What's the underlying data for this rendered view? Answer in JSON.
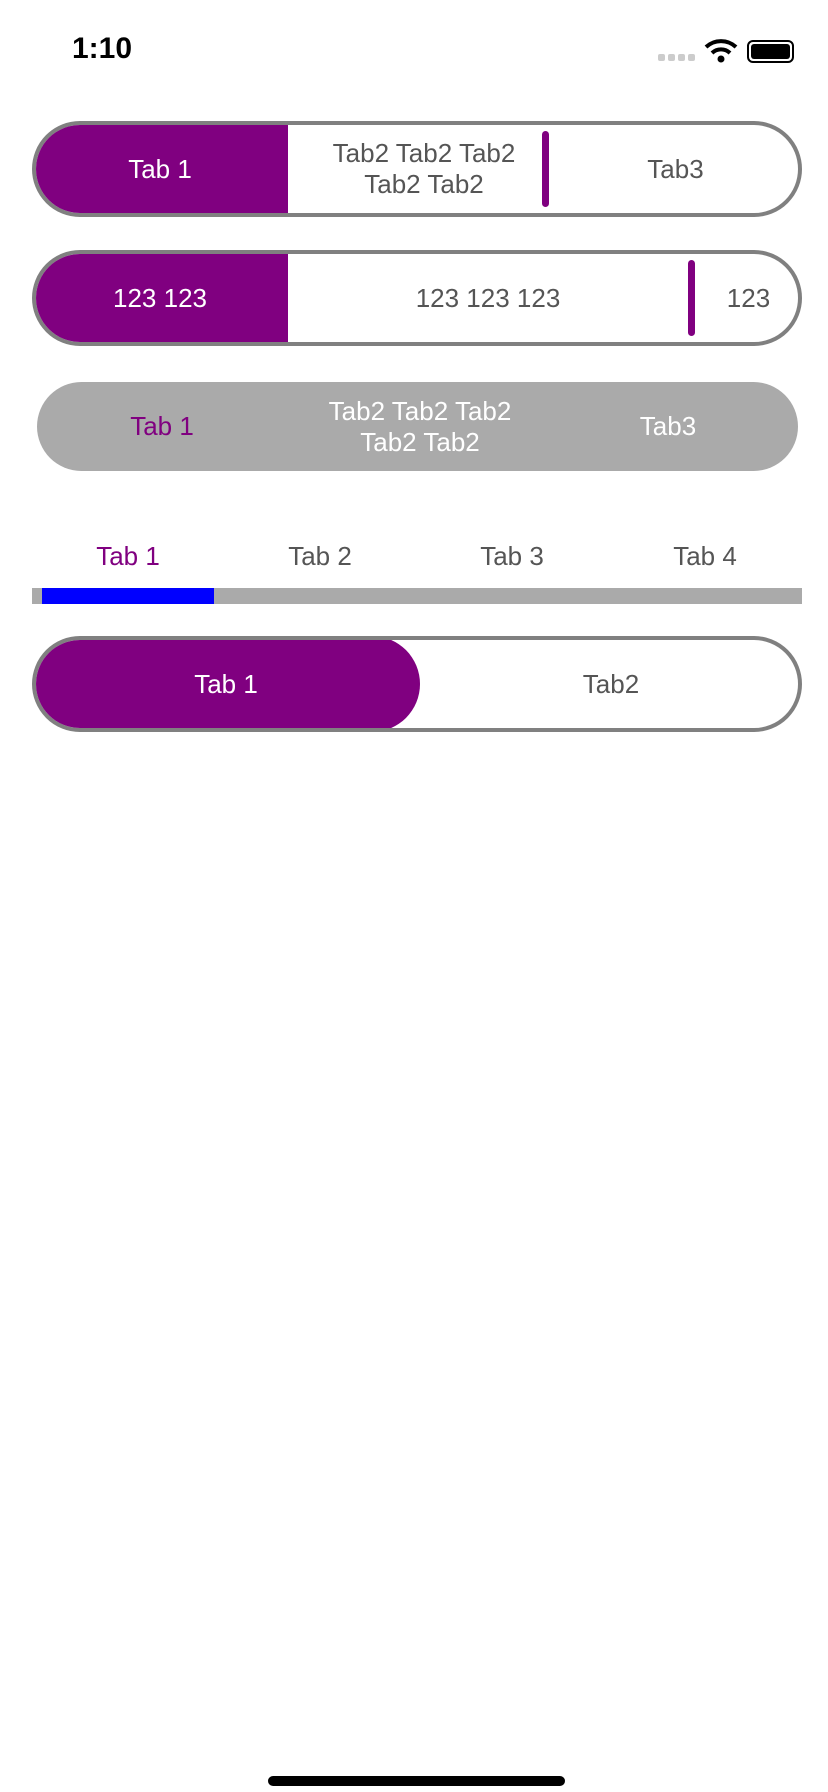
{
  "status_bar": {
    "time": "1:10",
    "signal": "signal-dots-icon",
    "wifi": "wifi-icon",
    "battery": "battery-icon"
  },
  "colors": {
    "accent": "#800080",
    "indicator": "#0000ff",
    "track": "#aaaaaa",
    "border": "#808080"
  },
  "segmented1": {
    "tabs": [
      "Tab 1",
      "Tab2 Tab2 Tab2 Tab2 Tab2",
      "Tab3"
    ],
    "selected": 0
  },
  "segmented2": {
    "tabs": [
      "123 123",
      "123 123 123",
      "123"
    ],
    "selected": 0
  },
  "segmented3": {
    "tabs": [
      "Tab 1",
      "Tab2 Tab2 Tab2 Tab2 Tab2",
      "Tab3"
    ],
    "selected": 0
  },
  "tabbar": {
    "tabs": [
      "Tab 1",
      "Tab 2",
      "Tab 3",
      "Tab 4"
    ],
    "selected": 0
  },
  "segmented4": {
    "tabs": [
      "Tab 1",
      "Tab2"
    ],
    "selected": 0
  }
}
